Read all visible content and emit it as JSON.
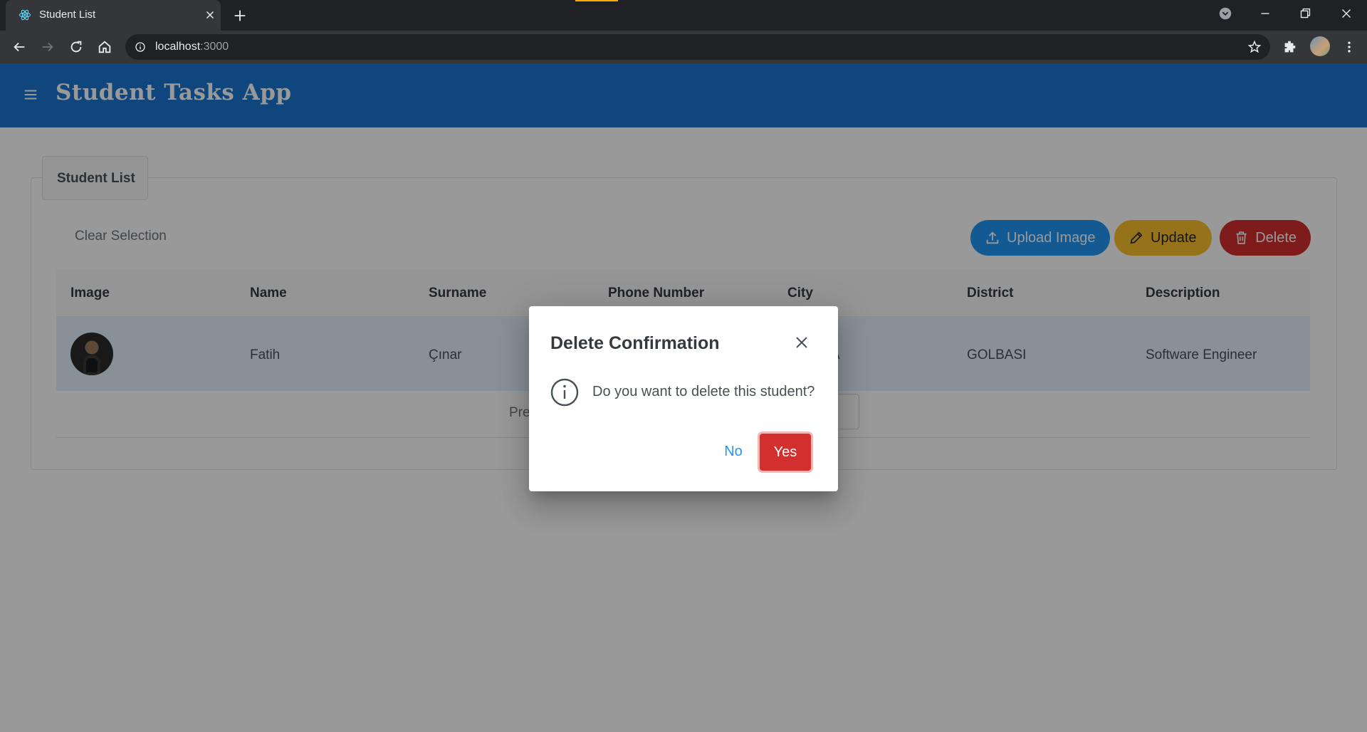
{
  "browser": {
    "tab_title": "Student List",
    "url_host": "localhost",
    "url_port": ":3000"
  },
  "app": {
    "title": "Student Tasks App"
  },
  "panel": {
    "legend": "Student List",
    "clear_selection": "Clear Selection",
    "buttons": {
      "upload": "Upload Image",
      "update": "Update",
      "delete": "Delete"
    }
  },
  "table": {
    "columns": [
      "Image",
      "Name",
      "Surname",
      "Phone Number",
      "City",
      "District",
      "Description"
    ],
    "rows": [
      {
        "name": "Fatih",
        "surname": "Çınar",
        "city_visible": "A",
        "district": "GOLBASI",
        "description": "Software Engineer"
      }
    ]
  },
  "paginator": {
    "prev_partial": "Pre"
  },
  "dialog": {
    "title": "Delete Confirmation",
    "message": "Do you want to delete this student?",
    "no_label": "No",
    "yes_label": "Yes"
  },
  "colors": {
    "appbar": "#1976d2",
    "upload": "#2196f3",
    "update": "#fbc02d",
    "delete": "#d32f2f",
    "selected_row": "#e3f2fd"
  }
}
